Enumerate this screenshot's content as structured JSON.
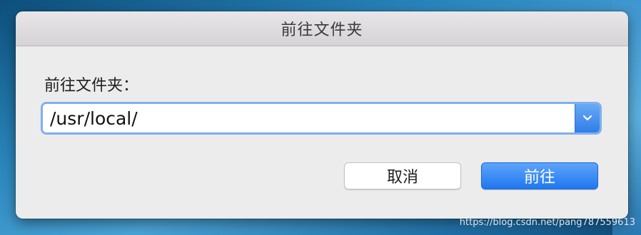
{
  "dialog": {
    "title": "前往文件夹",
    "prompt_label": "前往文件夹：",
    "path_input": {
      "value": "/usr/local/",
      "has_dropdown": true
    },
    "icons": {
      "dropdown": "chevron-down-icon"
    },
    "buttons": {
      "cancel_label": "取消",
      "go_label": "前往"
    }
  },
  "watermark": "https://blog.csdn.net/pang787559613",
  "colors": {
    "accent": "#2f7ee8",
    "focus_ring": "#7fb0ec",
    "dialog_bg": "#ececec"
  }
}
